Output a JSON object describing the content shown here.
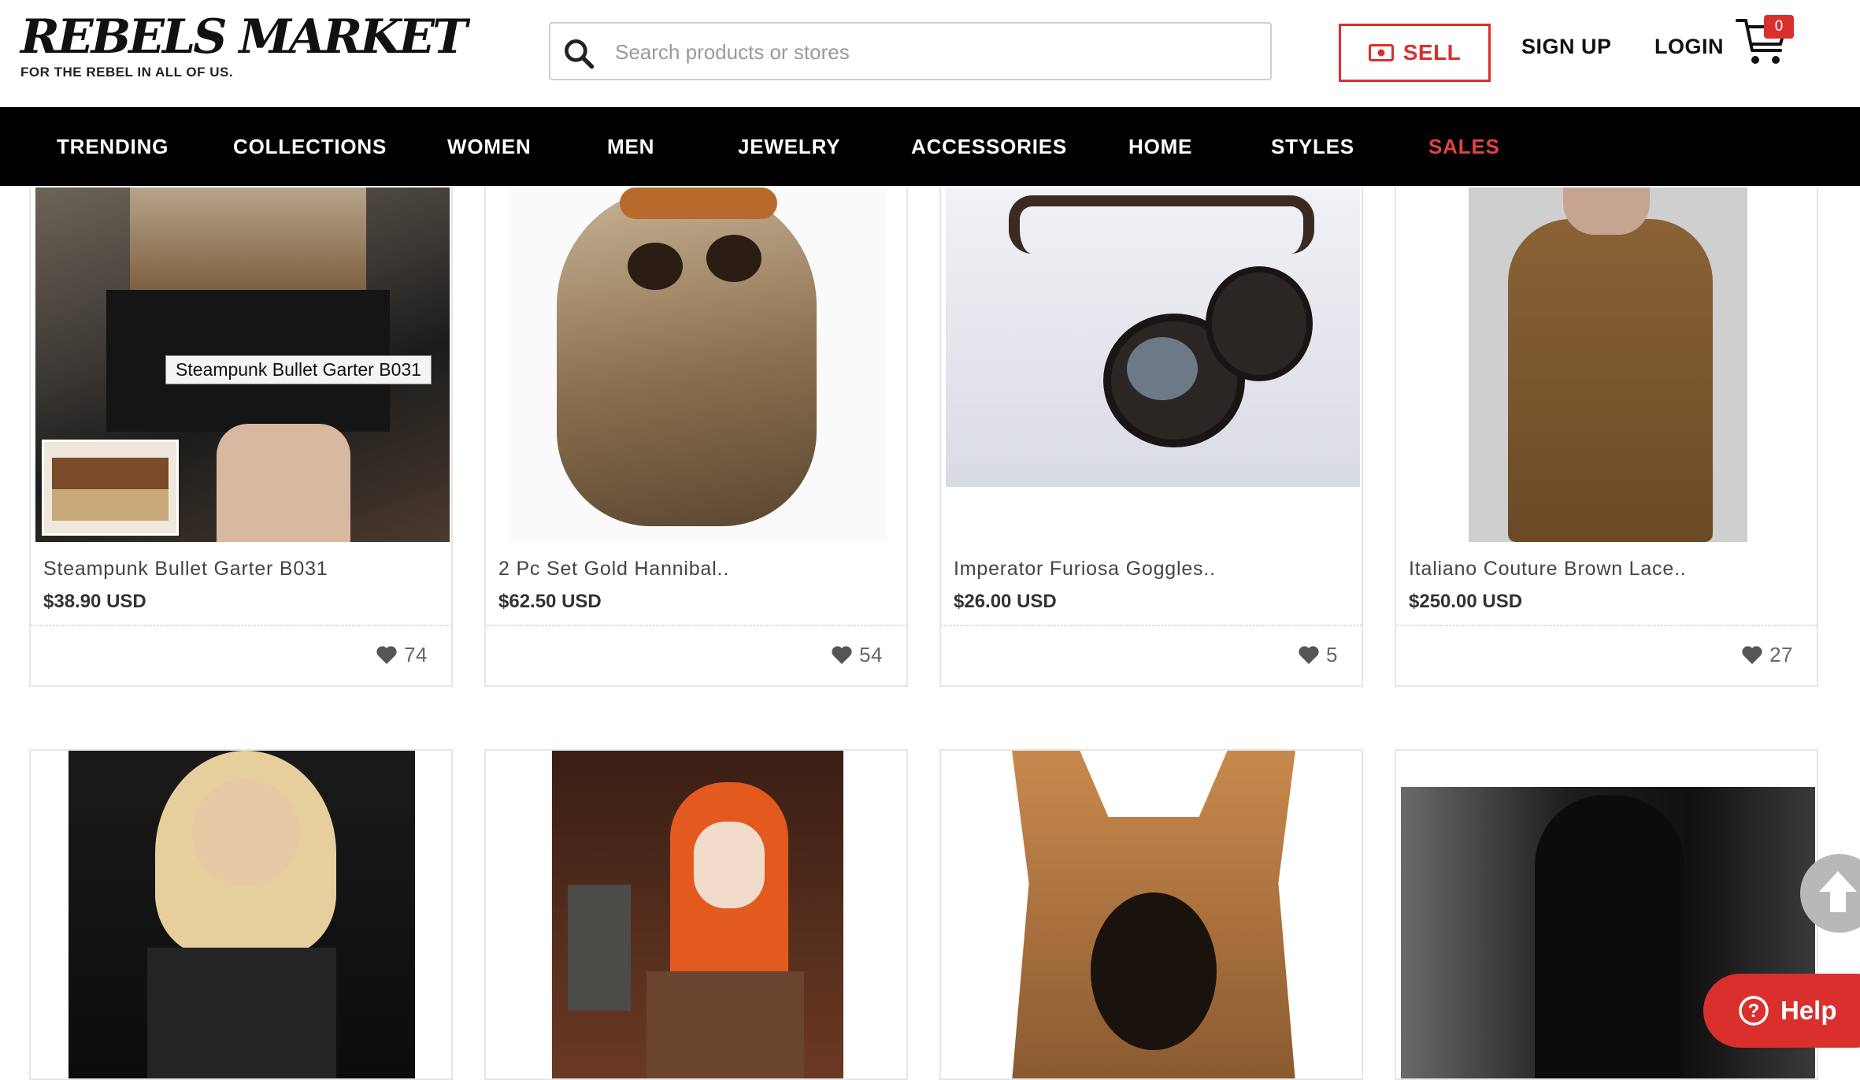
{
  "brand": {
    "name": "REBELS MARKET",
    "tagline": "FOR THE REBEL IN ALL OF US."
  },
  "search": {
    "placeholder": "Search products or stores",
    "value": ""
  },
  "header": {
    "sell_label": "SELL",
    "signup_label": "SIGN UP",
    "login_label": "LOGIN",
    "cart_count": "0"
  },
  "nav": {
    "items": [
      "TRENDING",
      "COLLECTIONS",
      "WOMEN",
      "MEN",
      "JEWELRY",
      "ACCESSORIES",
      "HOME",
      "STYLES",
      "SALES"
    ]
  },
  "products": [
    {
      "title": "Steampunk Bullet Garter B031",
      "price": "$38.90 USD",
      "likes": "74"
    },
    {
      "title": "2 Pc Set Gold Hannibal..",
      "price": "$62.50 USD",
      "likes": "54"
    },
    {
      "title": "Imperator Furiosa Goggles..",
      "price": "$26.00 USD",
      "likes": "5"
    },
    {
      "title": "Italiano Couture Brown Lace..",
      "price": "$250.00 USD",
      "likes": "27"
    }
  ],
  "tooltip": {
    "text": "Steampunk Bullet Garter B031"
  },
  "help": {
    "label": "Help"
  },
  "colors": {
    "accent": "#d9302e",
    "nav_bg": "#000000",
    "sales": "#e0443f"
  },
  "icons": [
    "search-icon",
    "money-icon",
    "cart-icon",
    "heart-icon",
    "arrow-up-icon",
    "question-icon"
  ]
}
